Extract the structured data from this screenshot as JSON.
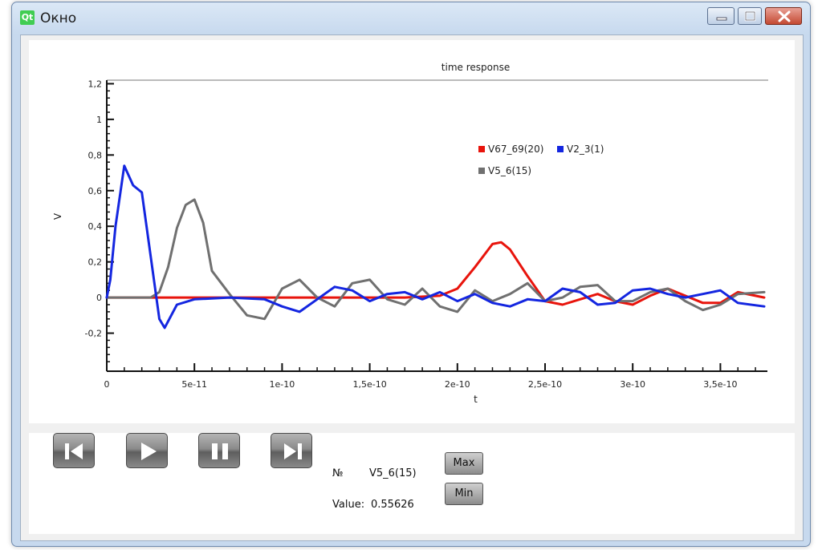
{
  "window": {
    "title": "Окно",
    "app_icon_text": "Qt"
  },
  "chart_data": {
    "type": "line",
    "title": "time response",
    "xlabel": "t",
    "ylabel": "V",
    "xlim": [
      0,
      3.75e-10
    ],
    "ylim": [
      -0.4,
      1.22
    ],
    "x_ticks": [
      {
        "value": 0,
        "label": "0"
      },
      {
        "value": 5e-11,
        "label": "5e-11"
      },
      {
        "value": 1e-10,
        "label": "1e-10"
      },
      {
        "value": 1.5e-10,
        "label": "1,5e-10"
      },
      {
        "value": 2e-10,
        "label": "2e-10"
      },
      {
        "value": 2.5e-10,
        "label": "2,5e-10"
      },
      {
        "value": 3e-10,
        "label": "3e-10"
      },
      {
        "value": 3.5e-10,
        "label": "3,5e-10"
      }
    ],
    "y_ticks": [
      {
        "value": -0.2,
        "label": "-0,2"
      },
      {
        "value": 0,
        "label": "0"
      },
      {
        "value": 0.2,
        "label": "0,2"
      },
      {
        "value": 0.4,
        "label": "0,4"
      },
      {
        "value": 0.6,
        "label": "0,6"
      },
      {
        "value": 0.8,
        "label": "0,8"
      },
      {
        "value": 1.0,
        "label": "1"
      },
      {
        "value": 1.2,
        "label": "1,2"
      }
    ],
    "legend_placement": "top-right",
    "grid": false,
    "series": [
      {
        "name": "V67_69(20)",
        "color": "#e8140c",
        "x": [
          0,
          1e-10,
          1.7e-10,
          1.9e-10,
          2e-10,
          2.1e-10,
          2.2e-10,
          2.25e-10,
          2.3e-10,
          2.4e-10,
          2.5e-10,
          2.6e-10,
          2.7e-10,
          2.8e-10,
          2.9e-10,
          3e-10,
          3.1e-10,
          3.2e-10,
          3.3e-10,
          3.4e-10,
          3.5e-10,
          3.6e-10,
          3.75e-10
        ],
        "y": [
          0,
          0,
          0,
          0.01,
          0.05,
          0.17,
          0.3,
          0.31,
          0.27,
          0.12,
          -0.02,
          -0.04,
          -0.01,
          0.02,
          -0.02,
          -0.04,
          0.01,
          0.05,
          0.01,
          -0.03,
          -0.03,
          0.03,
          0
        ]
      },
      {
        "name": "V2_3(1)",
        "color": "#1426e0",
        "x": [
          0,
          2e-12,
          5e-12,
          1e-11,
          1.5e-11,
          2e-11,
          3e-11,
          3.3e-11,
          4e-11,
          5e-11,
          7e-11,
          9e-11,
          1e-10,
          1.1e-10,
          1.2e-10,
          1.3e-10,
          1.4e-10,
          1.5e-10,
          1.6e-10,
          1.7e-10,
          1.8e-10,
          1.9e-10,
          2e-10,
          2.1e-10,
          2.2e-10,
          2.3e-10,
          2.4e-10,
          2.5e-10,
          2.6e-10,
          2.7e-10,
          2.8e-10,
          2.9e-10,
          3e-10,
          3.1e-10,
          3.2e-10,
          3.3e-10,
          3.4e-10,
          3.5e-10,
          3.6e-10,
          3.75e-10
        ],
        "y": [
          0,
          0.1,
          0.4,
          0.74,
          0.63,
          0.59,
          -0.12,
          -0.17,
          -0.04,
          -0.01,
          0,
          -0.01,
          -0.05,
          -0.08,
          -0.01,
          0.06,
          0.04,
          -0.02,
          0.02,
          0.03,
          -0.01,
          0.03,
          -0.02,
          0.02,
          -0.03,
          -0.05,
          -0.01,
          -0.02,
          0.05,
          0.03,
          -0.04,
          -0.03,
          0.04,
          0.05,
          0.02,
          0,
          0.02,
          0.04,
          -0.03,
          -0.05
        ]
      },
      {
        "name": "V5_6(15)",
        "color": "#707070",
        "x": [
          0,
          2.5e-11,
          3e-11,
          3.5e-11,
          4e-11,
          4.5e-11,
          5e-11,
          5.5e-11,
          6e-11,
          7e-11,
          8e-11,
          9e-11,
          1e-10,
          1.1e-10,
          1.2e-10,
          1.3e-10,
          1.4e-10,
          1.5e-10,
          1.6e-10,
          1.7e-10,
          1.8e-10,
          1.9e-10,
          2e-10,
          2.1e-10,
          2.2e-10,
          2.3e-10,
          2.4e-10,
          2.5e-10,
          2.6e-10,
          2.7e-10,
          2.8e-10,
          2.9e-10,
          3e-10,
          3.1e-10,
          3.2e-10,
          3.3e-10,
          3.4e-10,
          3.5e-10,
          3.6e-10,
          3.75e-10
        ],
        "y": [
          0,
          0,
          0.03,
          0.17,
          0.39,
          0.52,
          0.55,
          0.42,
          0.15,
          0.02,
          -0.1,
          -0.12,
          0.05,
          0.1,
          0,
          -0.05,
          0.08,
          0.1,
          -0.01,
          -0.04,
          0.05,
          -0.05,
          -0.08,
          0.04,
          -0.02,
          0.02,
          0.08,
          -0.02,
          0,
          0.06,
          0.07,
          -0.02,
          -0.02,
          0.03,
          0.05,
          -0.02,
          -0.07,
          -0.04,
          0.02,
          0.03
        ]
      }
    ]
  },
  "player": {
    "number_label": "№",
    "current_series": "V5_6(15)",
    "value_label": "Value:",
    "value": "0.55626",
    "max_label": "Max",
    "min_label": "Min"
  }
}
